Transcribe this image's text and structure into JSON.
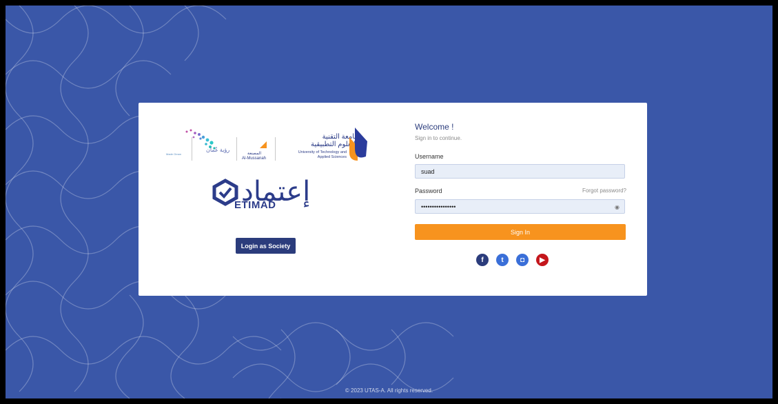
{
  "brand": {
    "utas_ar": "جامعة التقنية\nوالعلوم التطبيقية",
    "utas_en": "University of Technology and Applied Sciences",
    "musannah_ar": "المصنعة",
    "musannah_en": "Al-Mussanah",
    "vision": "رؤية عُمان",
    "small_text": "Made Oman",
    "etimad_ar": "إعتماد",
    "etimad_en": "ETIMAD"
  },
  "society_button": "Login as Society",
  "login": {
    "welcome": "Welcome !",
    "subtitle": "Sign in to continue.",
    "username_label": "Username",
    "username_value": "suad",
    "password_label": "Password",
    "password_value": "••••••••••••••••",
    "forgot": "Forgot password?",
    "eye_icon": "◉",
    "submit": "Sign In"
  },
  "socials": [
    {
      "name": "facebook-icon",
      "glyph": "f",
      "color": "#2b3c7c"
    },
    {
      "name": "twitter-icon",
      "glyph": "t",
      "color": "#3a6fd8"
    },
    {
      "name": "instagram-icon",
      "glyph": "◘",
      "color": "#3a6fd8"
    },
    {
      "name": "youtube-icon",
      "glyph": "▶",
      "color": "#c4161c"
    }
  ],
  "footer": "© 2023 UTAS-A. All rights reserved.",
  "colors": {
    "background": "#3a57a8",
    "primary": "#2b3c7c",
    "accent": "#f7931e"
  }
}
